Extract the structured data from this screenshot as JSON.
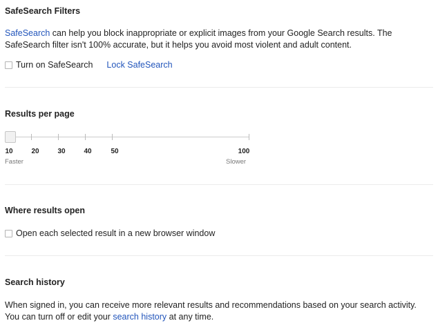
{
  "safesearch": {
    "heading": "SafeSearch Filters",
    "link": "SafeSearch",
    "text_1": " can help you block inappropriate or explicit images from your Google Search results. The SafeSearch filter isn't 100% accurate, but it helps you avoid most violent and adult content.",
    "checkbox_label": "Turn on SafeSearch",
    "checked": false,
    "lock_link": "Lock SafeSearch"
  },
  "results_per_page": {
    "heading": "Results per page",
    "selected": 10,
    "ticks": [
      "10",
      "20",
      "30",
      "40",
      "50",
      "100"
    ],
    "faster_label": "Faster",
    "slower_label": "Slower"
  },
  "where_results_open": {
    "heading": "Where results open",
    "checkbox_label": "Open each selected result in a new browser window",
    "checked": false
  },
  "search_history": {
    "heading": "Search history",
    "text_1": "When signed in, you can receive more relevant results and recommendations based on your search activity. You can turn off or edit your ",
    "link": "search history",
    "text_2": " at any time."
  }
}
